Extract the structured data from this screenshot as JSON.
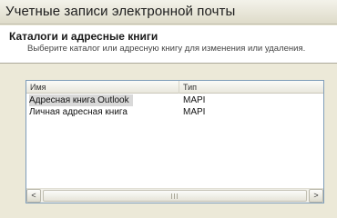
{
  "window": {
    "title": "Учетные записи электронной почты"
  },
  "section": {
    "title": "Каталоги и адресные книги",
    "description": "Выберите каталог или адресную книгу для изменения или удаления."
  },
  "list": {
    "columns": [
      "Имя",
      "Тип"
    ],
    "rows": [
      {
        "name": "Адресная книга Outlook",
        "type": "MAPI",
        "selected": true
      },
      {
        "name": "Личная адресная книга",
        "type": "MAPI",
        "selected": false
      }
    ]
  },
  "scrollbar": {
    "left_glyph": "<",
    "right_glyph": ">"
  }
}
